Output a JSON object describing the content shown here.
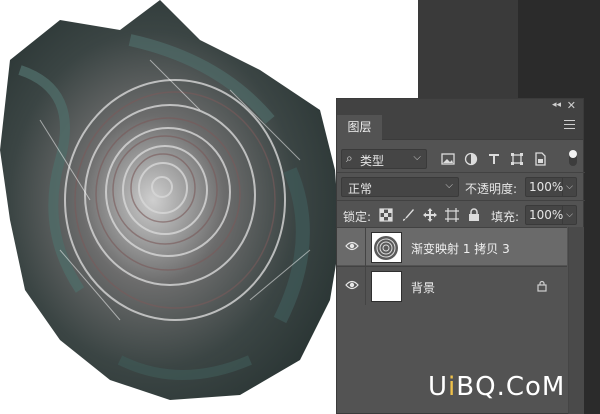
{
  "panel": {
    "tab_label": "图层",
    "collapse_glyph": "◂◂",
    "close_glyph": "✕",
    "filter": {
      "kind_label": "类型",
      "icons": [
        "image-filter-icon",
        "adjustment-filter-icon",
        "type-filter-icon",
        "shape-filter-icon",
        "smart-object-filter-icon"
      ],
      "toggle_on": true
    },
    "blend_mode": "正常",
    "opacity_label": "不透明度:",
    "opacity_value": "100%",
    "lock_label": "锁定:",
    "fill_label": "填充:",
    "fill_value": "100%",
    "layers": [
      {
        "name": "渐变映射 1 拷贝 3",
        "visible": true,
        "selected": true,
        "locked": false,
        "thumbnail": "rose"
      },
      {
        "name": "背景",
        "visible": true,
        "selected": false,
        "locked": true,
        "thumbnail": "white"
      }
    ]
  },
  "watermark": {
    "part1": "U",
    "part2": "i",
    "part3": "BQ.CoM"
  },
  "colors": {
    "panel_bg": "#535353",
    "selected_layer": "#6a6a6a",
    "pasteboard": "#2b2b2b",
    "watermark_accent": "#f0c24a"
  }
}
